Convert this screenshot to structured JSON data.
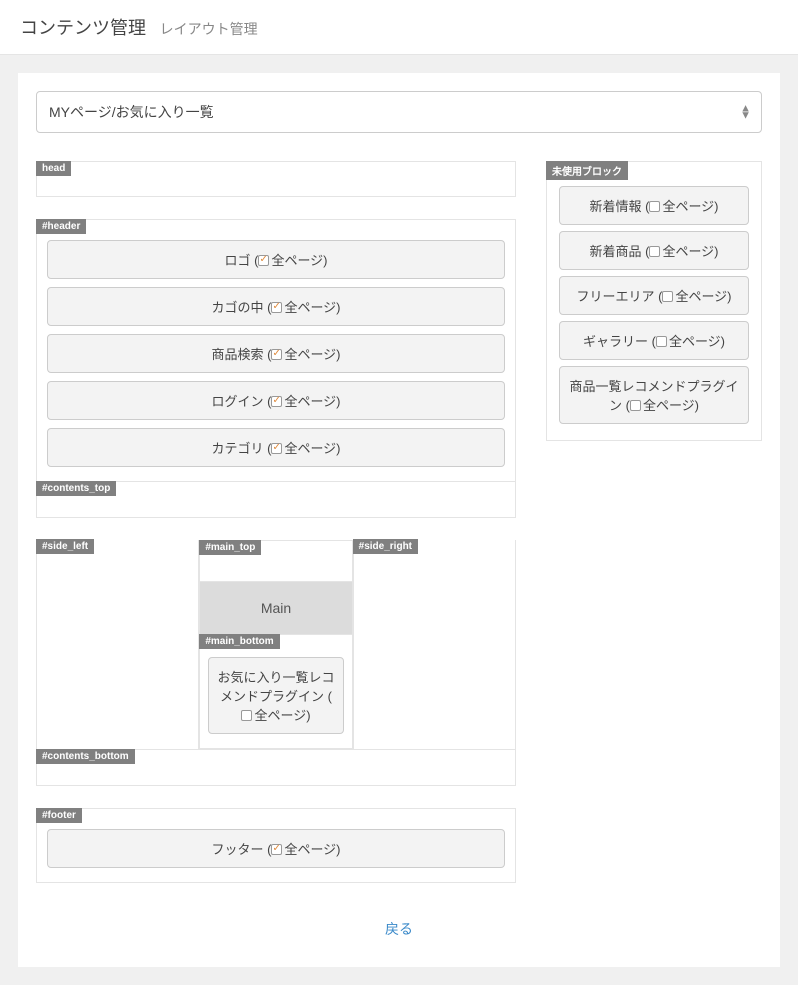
{
  "header": {
    "title": "コンテンツ管理",
    "subtitle": "レイアウト管理"
  },
  "page_select": {
    "value": "MYページ/お気に入り一覧"
  },
  "regions": {
    "head": {
      "label": "head",
      "blocks": []
    },
    "header": {
      "label": "#header",
      "blocks": [
        {
          "name": "ロゴ",
          "all_pages": true
        },
        {
          "name": "カゴの中",
          "all_pages": true
        },
        {
          "name": "商品検索",
          "all_pages": true
        },
        {
          "name": "ログイン",
          "all_pages": true
        },
        {
          "name": "カテゴリ",
          "all_pages": true
        }
      ]
    },
    "contents_top": {
      "label": "#contents_top",
      "blocks": []
    },
    "side_left": {
      "label": "#side_left",
      "blocks": []
    },
    "main_top": {
      "label": "#main_top",
      "blocks": []
    },
    "main": {
      "label": "Main"
    },
    "main_bottom": {
      "label": "#main_bottom",
      "blocks": [
        {
          "name": "お気に入り一覧レコメンドプラグイン",
          "all_pages": false
        }
      ]
    },
    "side_right": {
      "label": "#side_right",
      "blocks": []
    },
    "contents_bottom": {
      "label": "#contents_bottom",
      "blocks": []
    },
    "footer": {
      "label": "#footer",
      "blocks": [
        {
          "name": "フッター",
          "all_pages": true
        }
      ]
    }
  },
  "unused": {
    "label": "未使用ブロック",
    "blocks": [
      {
        "name": "新着情報",
        "all_pages": false
      },
      {
        "name": "新着商品",
        "all_pages": false
      },
      {
        "name": "フリーエリア",
        "all_pages": false
      },
      {
        "name": "ギャラリー",
        "all_pages": false
      },
      {
        "name": "商品一覧レコメンドプラグイン",
        "all_pages": false
      }
    ]
  },
  "labels": {
    "all_pages": "全ページ",
    "back": "戻る"
  }
}
